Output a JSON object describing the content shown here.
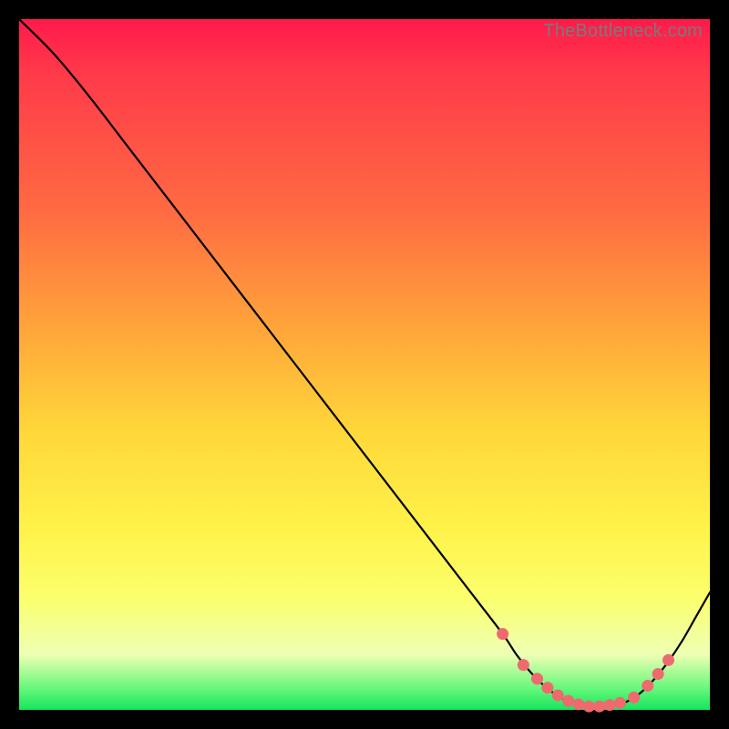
{
  "attribution": "TheBottleneck.com",
  "colors": {
    "dot": "#ee6a6f",
    "curve": "#000000",
    "frame_bg": "#000000"
  },
  "chart_data": {
    "type": "line",
    "title": "",
    "xlabel": "",
    "ylabel": "",
    "xlim": [
      0,
      100
    ],
    "ylim": [
      0,
      100
    ],
    "grid": false,
    "legend": false,
    "series": [
      {
        "name": "bottleneck-curve",
        "x": [
          0,
          5,
          10,
          15,
          20,
          25,
          30,
          35,
          40,
          45,
          50,
          55,
          60,
          65,
          70,
          72,
          74,
          76,
          78,
          80,
          82,
          84,
          86,
          88,
          90,
          92,
          94,
          96,
          98,
          100
        ],
        "y": [
          100,
          95,
          89,
          82.5,
          76,
          69.5,
          63,
          56.5,
          50,
          43.5,
          37,
          30.5,
          24,
          17.5,
          11,
          8,
          5.5,
          3.5,
          2,
          1,
          0.5,
          0.4,
          0.6,
          1.2,
          2.5,
          4.5,
          7,
          10,
          13.5,
          17
        ]
      }
    ],
    "highlighted_points": {
      "comment": "salmon dots along the valley floor",
      "x": [
        70,
        73,
        75,
        76.5,
        78,
        79.5,
        81,
        82.5,
        84,
        85.5,
        87,
        89,
        91,
        92.5,
        94
      ],
      "y": [
        11,
        6.5,
        4.5,
        3.2,
        2.1,
        1.3,
        0.8,
        0.5,
        0.5,
        0.7,
        1.0,
        1.8,
        3.5,
        5.2,
        7.2
      ]
    }
  }
}
